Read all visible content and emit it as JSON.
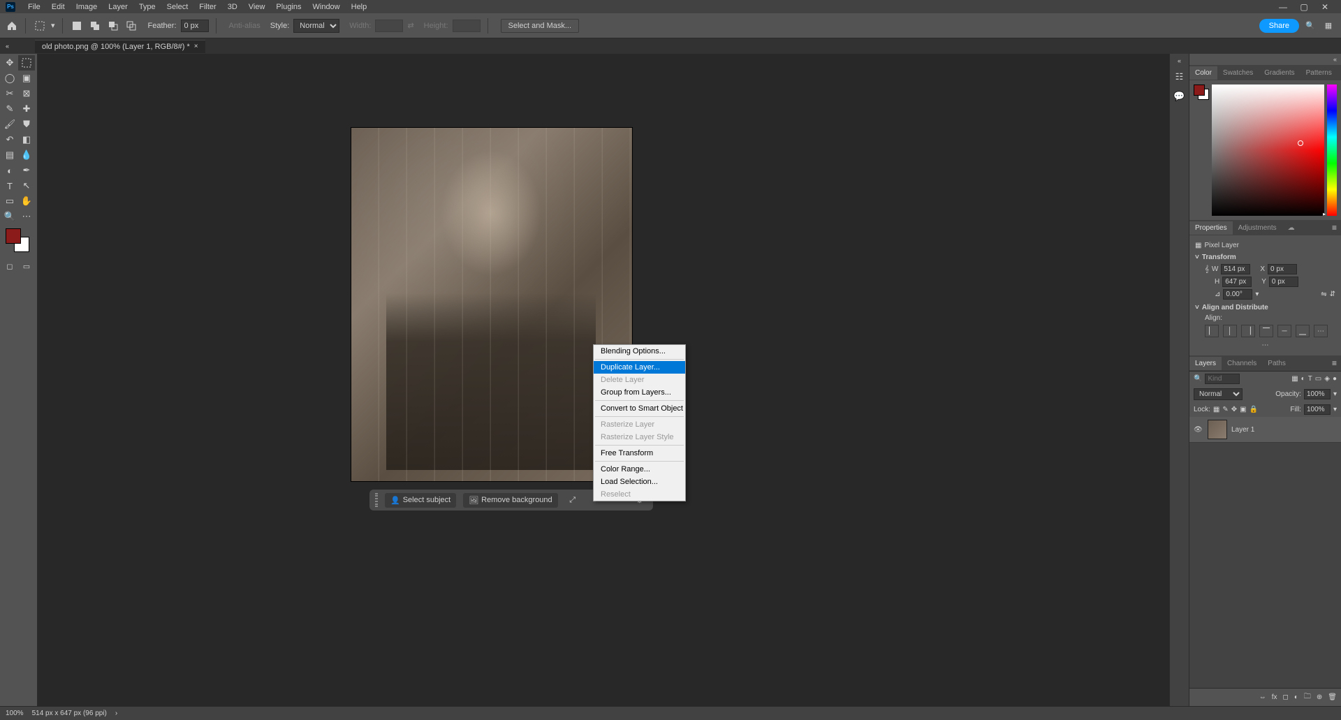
{
  "menubar": [
    "File",
    "Edit",
    "Image",
    "Layer",
    "Type",
    "Select",
    "Filter",
    "3D",
    "View",
    "Plugins",
    "Window",
    "Help"
  ],
  "options": {
    "feather_label": "Feather:",
    "feather_value": "0 px",
    "antialias": "Anti-alias",
    "style_label": "Style:",
    "style_value": "Normal",
    "width_label": "Width:",
    "height_label": "Height:",
    "select_mask": "Select and Mask...",
    "share": "Share"
  },
  "tab": {
    "title": "old photo.png @ 100% (Layer 1, RGB/8#) *"
  },
  "context_menu": {
    "items": [
      {
        "label": "Blending Options...",
        "state": "normal"
      },
      {
        "sep": true
      },
      {
        "label": "Duplicate Layer...",
        "state": "highlight"
      },
      {
        "label": "Delete Layer",
        "state": "disabled"
      },
      {
        "label": "Group from Layers...",
        "state": "normal"
      },
      {
        "sep": true
      },
      {
        "label": "Convert to Smart Object",
        "state": "normal"
      },
      {
        "sep": true
      },
      {
        "label": "Rasterize Layer",
        "state": "disabled"
      },
      {
        "label": "Rasterize Layer Style",
        "state": "disabled"
      },
      {
        "sep": true
      },
      {
        "label": "Free Transform",
        "state": "normal"
      },
      {
        "sep": true
      },
      {
        "label": "Color Range...",
        "state": "normal"
      },
      {
        "label": "Load Selection...",
        "state": "normal"
      },
      {
        "label": "Reselect",
        "state": "disabled"
      }
    ]
  },
  "action_bar": {
    "select_subject": "Select subject",
    "remove_bg": "Remove background"
  },
  "panels": {
    "color_tabs": [
      "Color",
      "Swatches",
      "Gradients",
      "Patterns"
    ],
    "props_tabs": [
      "Properties",
      "Adjustments"
    ],
    "props": {
      "type": "Pixel Layer",
      "transform": "Transform",
      "w_label": "W",
      "w_value": "514 px",
      "h_label": "H",
      "h_value": "647 px",
      "x_label": "X",
      "x_value": "0 px",
      "y_label": "Y",
      "y_value": "0 px",
      "angle_value": "0.00°",
      "align": "Align and Distribute",
      "align_label": "Align:"
    },
    "layers_tabs": [
      "Layers",
      "Channels",
      "Paths"
    ],
    "layers": {
      "kind_placeholder": "Kind",
      "blend": "Normal",
      "opacity_label": "Opacity:",
      "opacity_value": "100%",
      "lock_label": "Lock:",
      "fill_label": "Fill:",
      "fill_value": "100%",
      "items": [
        {
          "name": "Layer 1"
        }
      ]
    }
  },
  "status": {
    "zoom": "100%",
    "dims": "514 px x 647 px (96 ppi)"
  }
}
